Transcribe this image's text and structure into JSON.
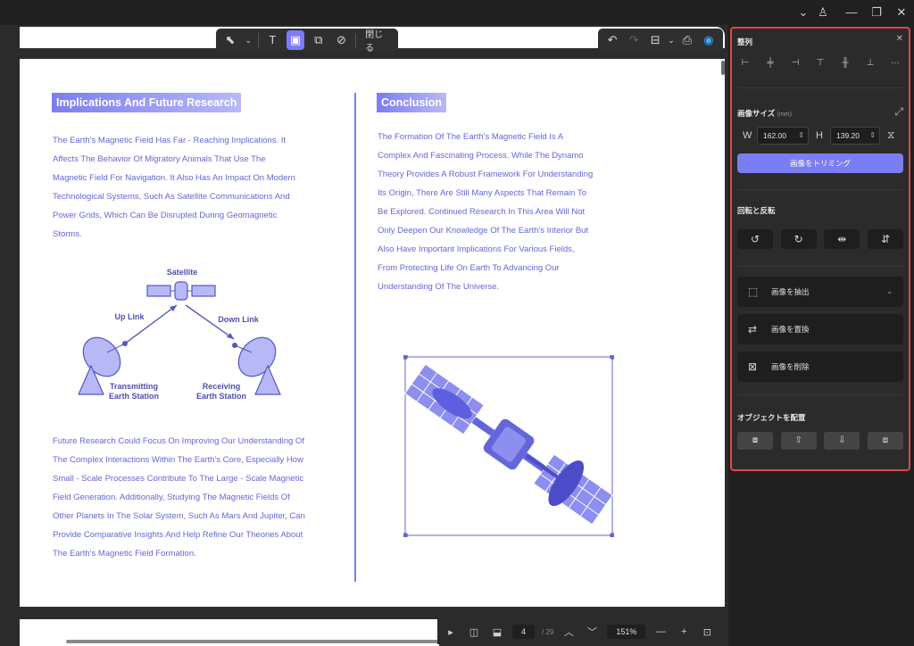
{
  "window": {
    "chevron": "⌄",
    "account": "♙",
    "minimize": "—",
    "restore": "❐",
    "close": "✕"
  },
  "edit_toolbar": {
    "select": "⬉",
    "dropdown": "⌄",
    "text": "T",
    "image": "▣",
    "crop": "⧉",
    "link": "⊘",
    "close_label": "閉じる"
  },
  "action_toolbar": {
    "undo": "↶",
    "redo": "↷",
    "save": "⊟",
    "dropdown": "⌄",
    "print": "⎙",
    "ai": "◉"
  },
  "page": {
    "left": {
      "heading": "Implications And Future Research",
      "paragraph1": [
        "The Earth's Magnetic Field Has Far - Reaching Implications. It",
        "Affects The Behavior Of Migratory Animals That Use The",
        "Magnetic Field For Navigation. It Also Has An Impact On Modern",
        "Technological Systems, Such As Satellite Communications And",
        "Power Grids, Which Can Be Disrupted During Geomagnetic",
        "Storms."
      ],
      "diagram": {
        "satellite": "Satellite",
        "uplink": "Up Link",
        "downlink": "Down Link",
        "transmitting": "Transmitting\nEarth Station",
        "receiving": "Receiving\nEarth Station"
      },
      "paragraph2": [
        "Future Research Could Focus On Improving Our Understanding Of",
        "The Complex Interactions Within The Earth's Core, Especially How",
        "Small - Scale Processes Contribute To The Large - Scale Magnetic",
        "Field Generation. Additionally, Studying The Magnetic Fields Of",
        "Other Planets In The Solar System, Such As Mars And Jupiter, Can",
        "Provide Comparative Insights And Help Refine Our Theories About",
        "The Earth's Magnetic Field Formation."
      ]
    },
    "right": {
      "heading": "Conclusion",
      "paragraph": [
        "The Formation Of The Earth's Magnetic Field Is A",
        "Complex And Fascinating Process. While The Dynamo",
        "Theory Provides A Robust Framework For Understanding",
        "Its Origin, There Are Still Many Aspects That Remain To",
        "Be Explored. Continued Research In This Area Will Not",
        "Only Deepen Our Knowledge Of The Earth's Interior But",
        "Also Have Important Implications For Various Fields,",
        "From Protecting Life On Earth To Advancing Our",
        "Understanding Of The Universe."
      ]
    }
  },
  "statusbar": {
    "play": "▸",
    "layout": "◫",
    "present": "⬓",
    "page_current": "4",
    "page_total": "/ 29",
    "prev": "︿",
    "next": "﹀",
    "zoom": "151%",
    "zoom_out": "—",
    "zoom_in": "+",
    "fit": "⊡"
  },
  "panel": {
    "title": "整列",
    "close": "✕",
    "align": [
      "⊢",
      "╪",
      "⊣",
      "⊤",
      "╫",
      "⊥",
      "···"
    ],
    "size_title": "画像サイズ",
    "size_unit": "(mm)",
    "expand": "⤢",
    "w_label": "W",
    "w_value": "162.00",
    "h_label": "H",
    "h_value": "139.20",
    "spin": "⇕",
    "lock": "⧖",
    "trim": "画像をトリミング",
    "rotate_title": "回転と反転",
    "rotate": [
      "↺",
      "↻",
      "⇹",
      "⇵"
    ],
    "extract": "画像を抽出",
    "extract_icon": "⬚",
    "extract_chev": "⌄",
    "replace": "画像を置換",
    "replace_icon": "⇄",
    "delete": "画像を削除",
    "delete_icon": "⊠",
    "arrange_title": "オブジェクトを配置",
    "arrange": [
      "⧇",
      "⇧",
      "⇩",
      "⧈"
    ]
  }
}
